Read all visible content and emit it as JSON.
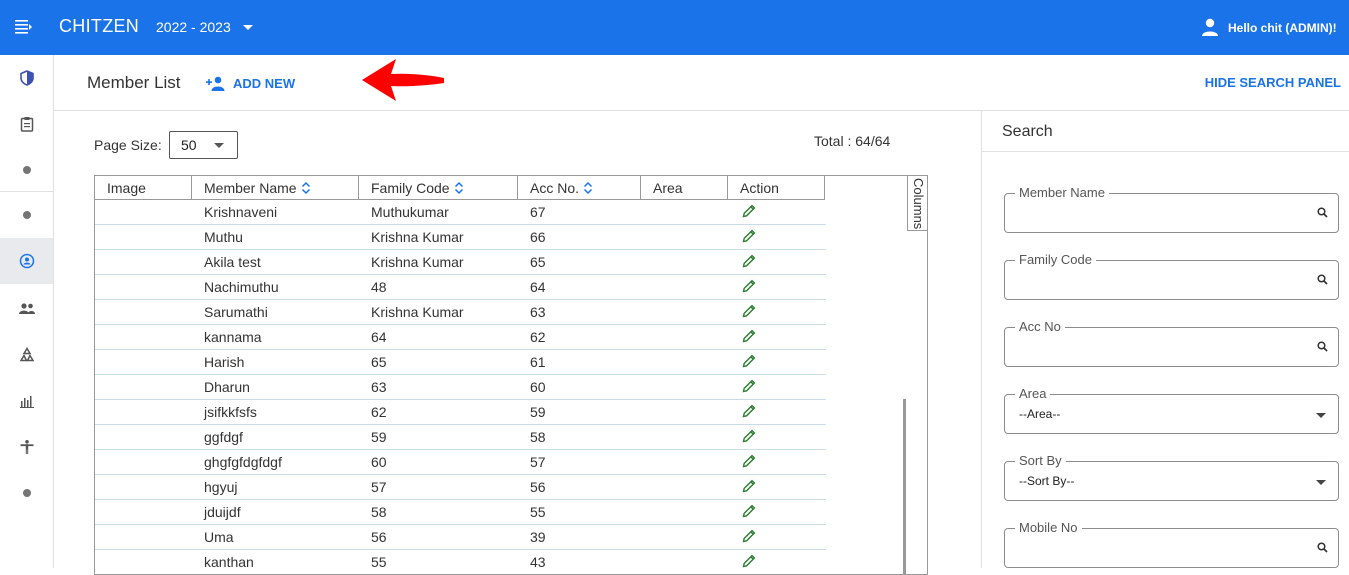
{
  "topbar": {
    "brand": "CHITZEN",
    "year": "2022 - 2023",
    "user_greeting": "Hello chit (ADMIN)!"
  },
  "header": {
    "title": "Member List",
    "add_new": "ADD NEW",
    "hide_search_panel": "HIDE SEARCH PANEL"
  },
  "list": {
    "page_size_label": "Page Size:",
    "page_size": "50",
    "total": "Total : 64/64",
    "columns_tab": "Columns",
    "columns": [
      "Image",
      "Member Name",
      "Family Code",
      "Acc No.",
      "Area",
      "Action"
    ],
    "rows": [
      {
        "name": "Krishnaveni",
        "family": "Muthukumar",
        "acc": "67"
      },
      {
        "name": "Muthu",
        "family": "Krishna Kumar",
        "acc": "66"
      },
      {
        "name": "Akila test",
        "family": "Krishna Kumar",
        "acc": "65"
      },
      {
        "name": "Nachimuthu",
        "family": "48",
        "acc": "64"
      },
      {
        "name": "Sarumathi",
        "family": "Krishna Kumar",
        "acc": "63"
      },
      {
        "name": "kannama",
        "family": "64",
        "acc": "62"
      },
      {
        "name": "Harish",
        "family": "65",
        "acc": "61"
      },
      {
        "name": "Dharun",
        "family": "63",
        "acc": "60"
      },
      {
        "name": "jsifkkfsfs",
        "family": "62",
        "acc": "59"
      },
      {
        "name": "ggfdgf",
        "family": "59",
        "acc": "58"
      },
      {
        "name": "ghgfgfdgfdgf",
        "family": "60",
        "acc": "57"
      },
      {
        "name": "hgyuj",
        "family": "57",
        "acc": "56"
      },
      {
        "name": "jduijdf",
        "family": "58",
        "acc": "55"
      },
      {
        "name": "Uma",
        "family": "56",
        "acc": "39"
      },
      {
        "name": "kanthan",
        "family": "55",
        "acc": "43"
      }
    ]
  },
  "search": {
    "title": "Search",
    "member_name": "Member Name",
    "family_code": "Family Code",
    "acc_no": "Acc No",
    "area_label": "Area",
    "area_value": "--Area--",
    "sort_label": "Sort By",
    "sort_value": "--Sort By--",
    "mobile_no": "Mobile No"
  },
  "sidebar_icons": [
    "menu-icon",
    "shield-icon",
    "clipboard-icon",
    "dot-icon",
    "dot-icon",
    "member-icon",
    "group-icon",
    "recycle-icon",
    "chart-icon",
    "person-icon",
    "dot-icon"
  ],
  "colors": {
    "primary": "#1a73e8",
    "edit_icon": "#2e7d32",
    "arrow": "#ff0000"
  }
}
